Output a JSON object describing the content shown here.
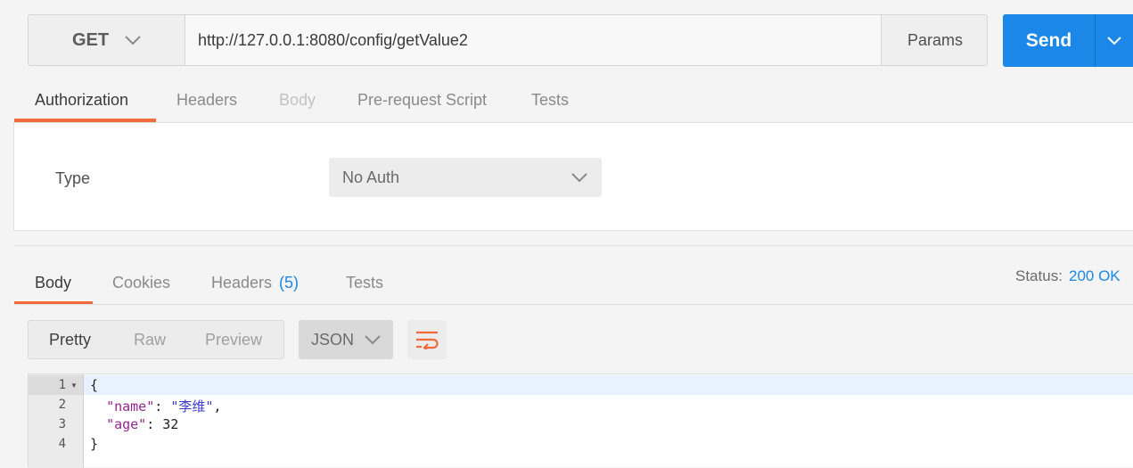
{
  "request": {
    "method": "GET",
    "url": "http://127.0.0.1:8080/config/getValue2",
    "params_label": "Params",
    "send_label": "Send"
  },
  "request_tabs": [
    "Authorization",
    "Headers",
    "Body",
    "Pre-request Script",
    "Tests"
  ],
  "auth": {
    "type_label": "Type",
    "type_value": "No Auth"
  },
  "response": {
    "tabs": {
      "body": "Body",
      "cookies": "Cookies",
      "headers": "Headers",
      "headers_count": "(5)",
      "tests": "Tests"
    },
    "status_label": "Status:",
    "status_value": "200 OK",
    "view_modes": [
      "Pretty",
      "Raw",
      "Preview"
    ],
    "format": "JSON"
  },
  "editor": {
    "line_numbers": [
      "1",
      "2",
      "3",
      "4"
    ],
    "lines": {
      "open": "{",
      "name_key": "\"name\"",
      "name_value": "\"李维\"",
      "age_key": "\"age\"",
      "age_value": "32",
      "close": "}"
    }
  },
  "colors": {
    "accent_orange": "#f26b3a",
    "send_blue": "#1b87e6",
    "json_key": "#92278f",
    "json_string": "#3a3ad0"
  }
}
